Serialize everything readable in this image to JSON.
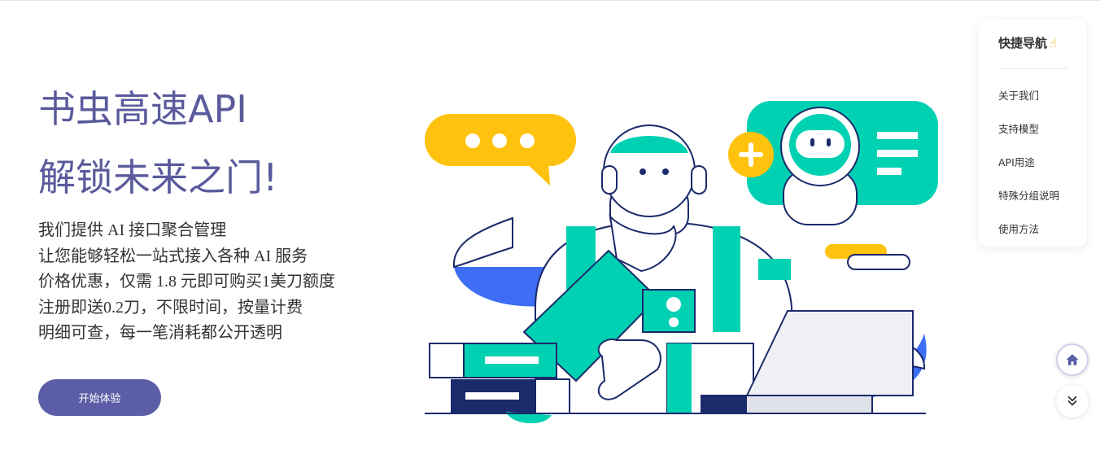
{
  "hero": {
    "title_line1": "书虫高速API",
    "title_line2": "解锁未来之门!",
    "description": [
      "我们提供 AI 接口聚合管理",
      "让您能够轻松一站式接入各种 AI 服务",
      "价格优惠，仅需 1.8 元即可购买1美刀额度",
      "注册即送0.2刀，不限时间，按量计费",
      "明细可查，每一笔消耗都公开透明"
    ],
    "start_button": "开始体验"
  },
  "quick_nav": {
    "title": "快捷导航",
    "title_icon": "pointing-hand-icon",
    "items": [
      "关于我们",
      "支持模型",
      "API用途",
      "特殊分组说明",
      "使用方法"
    ]
  },
  "floating_buttons": {
    "home_icon": "home-icon",
    "down_icon": "double-chevron-down-icon"
  },
  "colors": {
    "brand": "#5b5ea6",
    "title_text": "#5a5a9c",
    "teal": "#00d1b2",
    "yellow": "#ffc20e",
    "navy": "#1b2a6b",
    "blue": "#3d6ef5"
  }
}
